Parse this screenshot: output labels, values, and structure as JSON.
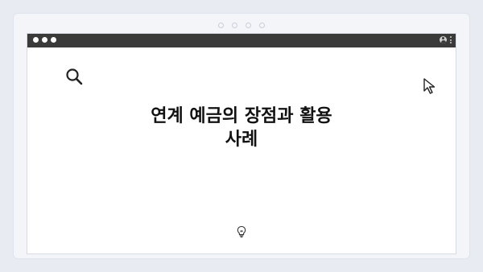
{
  "page": {
    "headline_line1": "연계 예금의 장점과 활용",
    "headline_line2": "사례"
  },
  "icons": {
    "search": "search-icon",
    "cursor": "cursor-arrow-icon",
    "bulb": "lightbulb-icon",
    "profile": "profile-icon",
    "menu": "kebab-menu-icon"
  },
  "colors": {
    "background": "#e8ecf2",
    "titlebar": "#3a3a3a",
    "content": "#ffffff",
    "text": "#111111"
  }
}
